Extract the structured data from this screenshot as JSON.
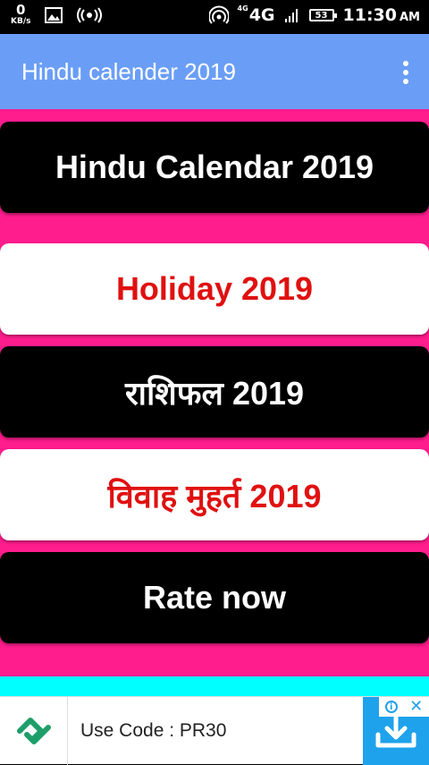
{
  "status_bar": {
    "net_speed": "0",
    "net_speed_unit": "KB/s",
    "network_label_small": "4G",
    "network_label": "4G",
    "battery": "53",
    "time": "11:30",
    "ampm": "AM"
  },
  "app_bar": {
    "title": "Hindu calender 2019"
  },
  "menu": {
    "items": [
      {
        "label": "Hindu Calendar 2019",
        "style": "black"
      },
      {
        "label": "Holiday 2019",
        "style": "white"
      },
      {
        "label": "राशिफल 2019",
        "style": "black"
      },
      {
        "label": "विवाह मुहर्त 2019",
        "style": "white"
      }
    ],
    "rate_label": "Rate now"
  },
  "ad": {
    "text": "Use Code : PR30",
    "info_label": "i"
  },
  "colors": {
    "app_bar": "#6A9EF6",
    "background": "#FF1C8D",
    "button_dark": "#000000",
    "button_light": "#FFFFFF",
    "accent_text": "#E01010",
    "strip": "#00FFFF",
    "ad_accent": "#1FA2EC"
  }
}
